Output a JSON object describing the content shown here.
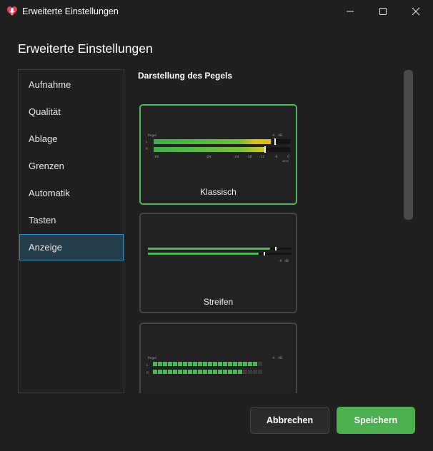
{
  "window": {
    "title": "Erweiterte Einstellungen"
  },
  "heading": "Erweiterte Einstellungen",
  "sidebar": {
    "items": [
      {
        "label": "Aufnahme"
      },
      {
        "label": "Qualität"
      },
      {
        "label": "Ablage"
      },
      {
        "label": "Grenzen"
      },
      {
        "label": "Automatik"
      },
      {
        "label": "Tasten"
      },
      {
        "label": "Anzeige",
        "active": true
      }
    ]
  },
  "section": {
    "title": "Darstellung des Pegels"
  },
  "styles": [
    {
      "label": "Klassisch",
      "selected": true,
      "preview": {
        "title": "Pegel",
        "peak_label": "-9",
        "peak_unit": "dB",
        "channel_labels": [
          "L",
          "R"
        ],
        "scale": [
          "-60",
          "-24",
          "-24",
          "-18",
          "-12",
          "-6",
          "0"
        ],
        "scale_unit": "dBFS",
        "levels": [
          0.86,
          0.82
        ]
      }
    },
    {
      "label": "Streifen",
      "selected": false,
      "preview": {
        "peak_label": "-9",
        "peak_unit": "dB",
        "levels": [
          0.85,
          0.77
        ]
      }
    },
    {
      "label": "",
      "selected": false,
      "preview": {
        "title": "Pegel",
        "peak_label": "-9",
        "peak_unit": "dB",
        "channel_labels": [
          "L",
          "R"
        ],
        "segments_total": 22,
        "segments_lit": [
          21,
          18
        ]
      }
    }
  ],
  "buttons": {
    "cancel": "Abbrechen",
    "save": "Speichern"
  },
  "colors": {
    "accent_green": "#4caf50",
    "selection_blue": "#3a8fc0",
    "window_bg": "#202020"
  },
  "icons": {
    "app": "microphone-heart-icon",
    "minimize": "minimize-icon",
    "maximize": "maximize-icon",
    "close": "close-icon"
  }
}
